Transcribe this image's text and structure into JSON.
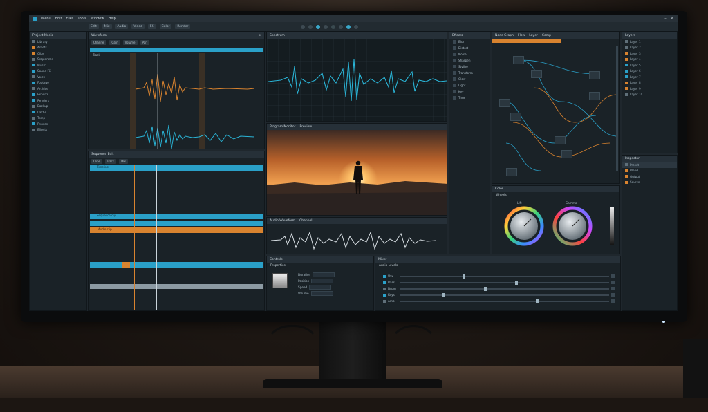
{
  "menu": {
    "items": [
      "Menu",
      "Edit",
      "Files",
      "Tools",
      "Window",
      "Help"
    ],
    "brand_color": "#2aa0c8",
    "accent_color": "#d8832f"
  },
  "toolbar": {
    "buttons": [
      "Edit",
      "Mix",
      "Audio",
      "Video",
      "FX",
      "Color",
      "Render"
    ],
    "play_icon": "play-icon",
    "record_icon": "record-icon"
  },
  "left_browser": {
    "title": "Project Media",
    "folder_label": "Library",
    "items": [
      "Assets",
      "Clips",
      "Sequences",
      "Music",
      "Sound FX",
      "Voice",
      "Footage",
      "Archive",
      "Exports",
      "Renders",
      "Backup",
      "Cache",
      "Temp",
      "Proxies",
      "Effects"
    ]
  },
  "waveform_panel": {
    "title": "Waveform",
    "tabs": [
      "Channel",
      "Gain",
      "Volume",
      "Pan"
    ],
    "track_label": "Track"
  },
  "timeline": {
    "title": "Sequence Edit",
    "header_clip": "Timeline",
    "tabs": [
      "Clips",
      "Track",
      "Mix"
    ],
    "clip_label": "Sequence clip",
    "clip_label_2": "Audio clip"
  },
  "center_wave": {
    "title": "Spectrum"
  },
  "preview": {
    "title": "Program Monitor",
    "status": "Preview"
  },
  "center_audio": {
    "title": "Audio Waveform",
    "tab2": "Channel"
  },
  "controls": {
    "title": "Controls",
    "sub": "Properties",
    "rows": [
      "Duration",
      "Position",
      "Speed",
      "Volume"
    ]
  },
  "mixer": {
    "title": "Mixer",
    "channel_label": "Audio Levels",
    "rows": [
      "Vox",
      "Bass",
      "Drum",
      "Keys",
      "Amb"
    ]
  },
  "effects": {
    "title": "Effects",
    "items": [
      "Blur",
      "Distort",
      "Noise",
      "Sharpen",
      "Stylize",
      "Transform",
      "Glow",
      "Light",
      "Key",
      "Time"
    ]
  },
  "node_graph": {
    "title": "Node Graph",
    "tabs": [
      "Flow",
      "Layer",
      "Comp"
    ]
  },
  "color_wheels": {
    "title": "Color",
    "sub": "Wheels",
    "wheels": [
      "Lift",
      "Gamma"
    ]
  },
  "right_tree": {
    "title": "Layers",
    "items": [
      "Layer 1",
      "Layer 2",
      "Layer 3",
      "Layer 4",
      "Layer 5",
      "Layer 6",
      "Layer 7",
      "Layer 8",
      "Layer 9",
      "Layer 10"
    ]
  },
  "right_lower": {
    "title": "Inspector",
    "items": [
      "Preset",
      "Blend",
      "Output",
      "Source"
    ]
  }
}
